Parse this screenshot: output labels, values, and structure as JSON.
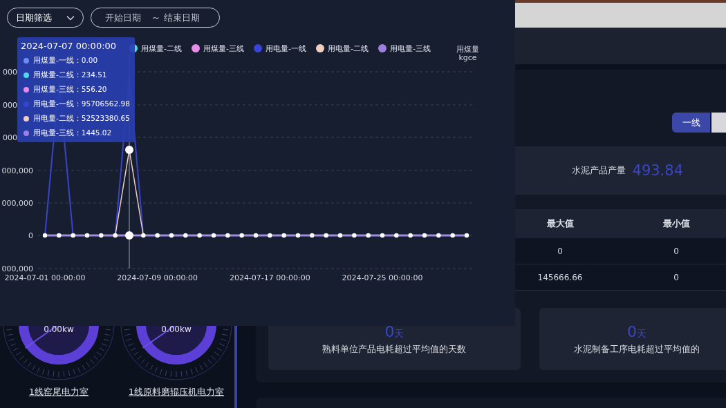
{
  "filter": {
    "label": "日期筛选"
  },
  "date_range": {
    "start_placeholder": "开始日期",
    "separator": "~",
    "end_placeholder": "结束日期"
  },
  "chart": {
    "legend": [
      {
        "name": "用煤量-二线",
        "color": "#4dd8f0"
      },
      {
        "name": "用煤量-三线",
        "color": "#e88ce8"
      },
      {
        "name": "用电量-一线",
        "color": "#3a44d8"
      },
      {
        "name": "用电量-二线",
        "color": "#f0cfc0"
      },
      {
        "name": "用电量-三线",
        "color": "#9d7fe0"
      }
    ],
    "unit_name": "用煤量",
    "unit": "kgce",
    "y_tick_labels": [
      "000",
      "000",
      "000",
      "000,000",
      "000,000",
      "0",
      "000,000"
    ],
    "x_tick_labels": [
      "2024-07-01 00:00:00",
      "2024-07-09 00:00:00",
      "2024-07-17 00:00:00",
      "2024-07-25 00:00:00"
    ],
    "tooltip": {
      "title": "2024-07-07 00:00:00",
      "rows": [
        {
          "text": "用煤量-一线：0.00",
          "color": "#6c8cf0"
        },
        {
          "text": "用煤量-二线：234.51",
          "color": "#4dd8f0"
        },
        {
          "text": "用煤量-三线：556.20",
          "color": "#e88ce8"
        },
        {
          "text": "用电量-一线：95706562.98",
          "color": "#3545d0"
        },
        {
          "text": "用电量-二线：52523380.65",
          "color": "#f0cfc0"
        },
        {
          "text": "用电量-三线：1445.02",
          "color": "#9d7fe0"
        }
      ]
    }
  },
  "line_tabs": [
    {
      "label": "一线",
      "selected": true
    }
  ],
  "summary_cards": [
    {
      "label": "水泥产品产量",
      "value": "493.84"
    }
  ],
  "table": {
    "columns": [
      "最大值",
      "最小值"
    ],
    "rows": [
      [
        "0",
        "0"
      ],
      [
        "145666.66",
        "0"
      ]
    ]
  },
  "day_cards": [
    {
      "value": "0",
      "unit": "天",
      "label": "熟料单位产品电耗超过平均值的天数"
    },
    {
      "value": "0",
      "unit": "天",
      "label": "水泥制备工序电耗超过平均值的"
    }
  ],
  "gauges": [
    {
      "reading": "0.00kw",
      "name": "1线窑尾电力室"
    },
    {
      "reading": "0.00kw",
      "name": "1线原料磨辊压机电力室"
    }
  ]
}
